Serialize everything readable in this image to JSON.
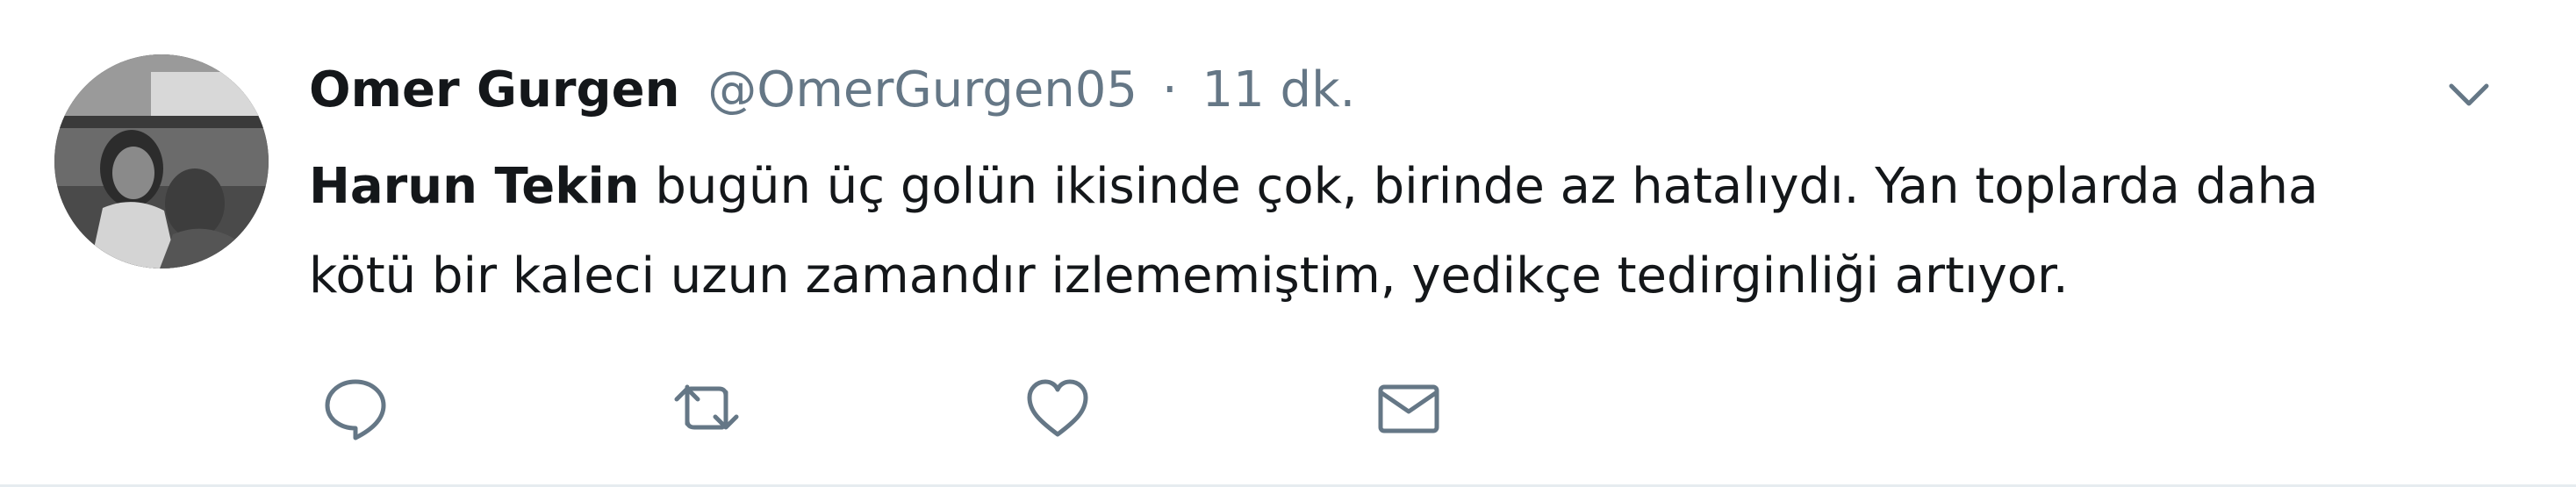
{
  "tweet": {
    "author_name": "Omer Gurgen",
    "author_handle": "@OmerGurgen05",
    "separator": "·",
    "time": "11 dk.",
    "mention": "Harun Tekin",
    "text_line1_rest": " bugün üç golün ikisinde çok, birinde az hatalıydı. Yan toplarda daha",
    "text_line2": "kötü bir kaleci uzun zamandır izlememiştim, yedikçe tedirginliği artıyor."
  },
  "icons": {
    "menu": "chevron-down-icon",
    "reply": "reply-icon",
    "retweet": "retweet-icon",
    "like": "heart-icon",
    "dm": "envelope-icon"
  },
  "colors": {
    "text": "#14171a",
    "secondary": "#657786",
    "icon": "#657786",
    "border": "#e6ecf0"
  }
}
